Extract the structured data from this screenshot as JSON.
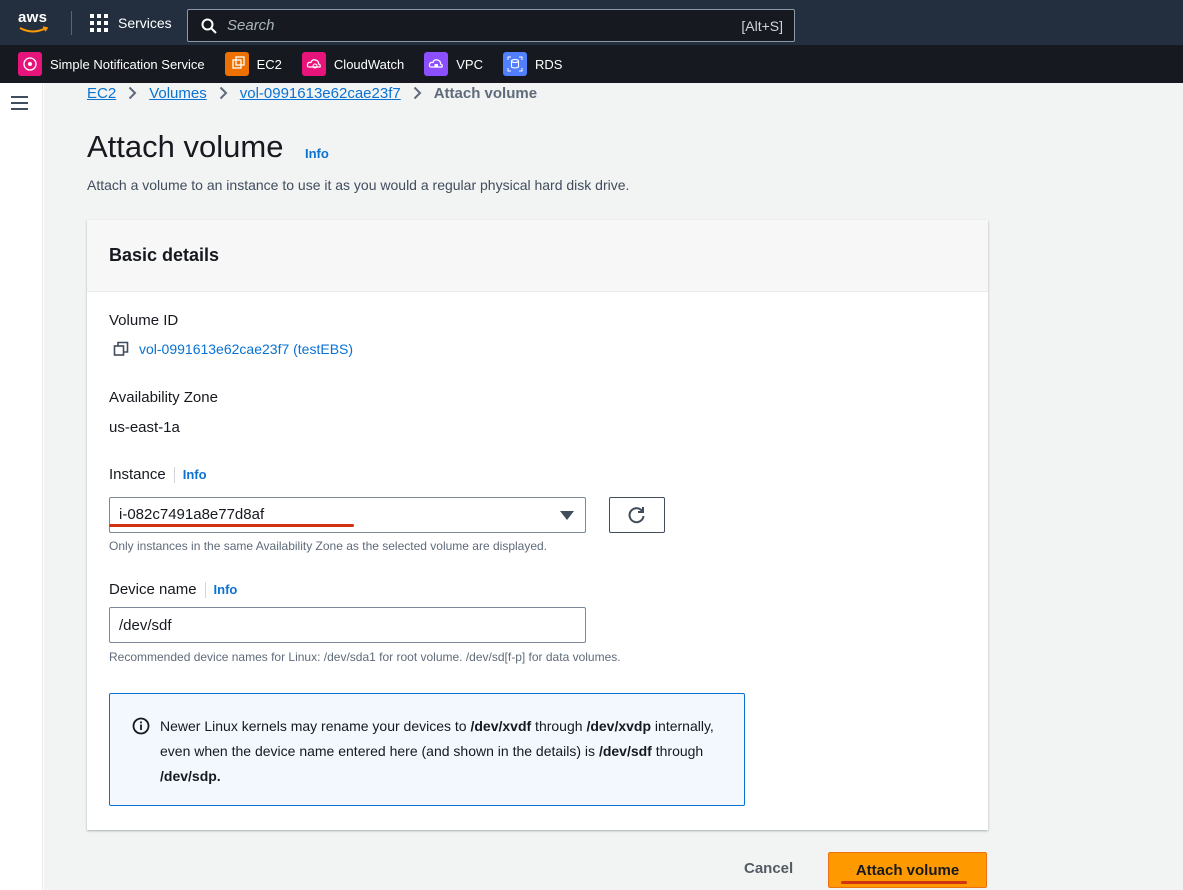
{
  "topnav": {
    "logo_text": "aws",
    "services_label": "Services",
    "search_placeholder": "Search",
    "search_shortcut": "[Alt+S]"
  },
  "favorites": [
    {
      "label": "Simple Notification Service",
      "icon": "sns-icon",
      "color": "#e7157b"
    },
    {
      "label": "EC2",
      "icon": "ec2-icon",
      "color": "#ed7100"
    },
    {
      "label": "CloudWatch",
      "icon": "cloudwatch-icon",
      "color": "#e7157b"
    },
    {
      "label": "VPC",
      "icon": "vpc-icon",
      "color": "#8c4fff"
    },
    {
      "label": "RDS",
      "icon": "rds-icon",
      "color": "#527fff"
    }
  ],
  "breadcrumb": {
    "items": [
      "EC2",
      "Volumes",
      "vol-0991613e62cae23f7"
    ],
    "current": "Attach volume"
  },
  "page": {
    "title": "Attach volume",
    "title_info": "Info",
    "description": "Attach a volume to an instance to use it as you would a regular physical hard disk drive."
  },
  "card": {
    "header": "Basic details",
    "volume_id_label": "Volume ID",
    "volume_id_value": "vol-0991613e62cae23f7 (testEBS)",
    "az_label": "Availability Zone",
    "az_value": "us-east-1a",
    "instance_label": "Instance",
    "instance_info": "Info",
    "instance_value": "i-082c7491a8e77d8af",
    "instance_hint": "Only instances in the same Availability Zone as the selected volume are displayed.",
    "device_label": "Device name",
    "device_info": "Info",
    "device_value": "/dev/sdf",
    "device_hint": "Recommended device names for Linux: /dev/sda1 for root volume. /dev/sd[f-p] for data volumes."
  },
  "alert": {
    "p1": "Newer Linux kernels may rename your devices to ",
    "b1": "/dev/xvdf",
    "p2": " through ",
    "b2": "/dev/xvdp",
    "p3": " internally, even when the device name entered here (and shown in the details) is ",
    "b3": "/dev/sdf",
    "p4": " through ",
    "b4": "/dev/sdp."
  },
  "actions": {
    "cancel": "Cancel",
    "attach": "Attach volume"
  },
  "colors": {
    "nav_bg": "#232f3e",
    "link": "#0972d3",
    "primary_button": "#ff9900",
    "annotation_red": "#d13212"
  }
}
